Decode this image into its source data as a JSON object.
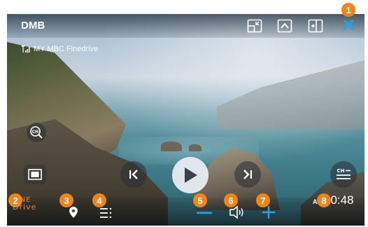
{
  "header": {
    "title": "DMB"
  },
  "channel": {
    "signal_text": "MY MBC Finedrive"
  },
  "brand": {
    "line1": "FINE",
    "line2": "Drive"
  },
  "clock": {
    "ampm": "AM",
    "time": "10:48"
  },
  "badges": [
    "1",
    "2",
    "3",
    "4",
    "5",
    "6",
    "7",
    "8"
  ],
  "icons": {
    "top": [
      "pip-icon",
      "collapse-up-icon",
      "split-screen-icon",
      "close-icon"
    ],
    "left": [
      "channel-search-icon",
      "screen-mode-icon"
    ],
    "playback": [
      "previous-icon",
      "play-icon",
      "next-icon"
    ],
    "right": [
      "channel-list-icon"
    ],
    "bottom": [
      "location-pin-icon",
      "menu-list-icon",
      "volume-down-icon",
      "speaker-icon",
      "volume-up-icon"
    ]
  },
  "colors": {
    "accent": "#1ea4ea",
    "badge": "#f08418"
  }
}
